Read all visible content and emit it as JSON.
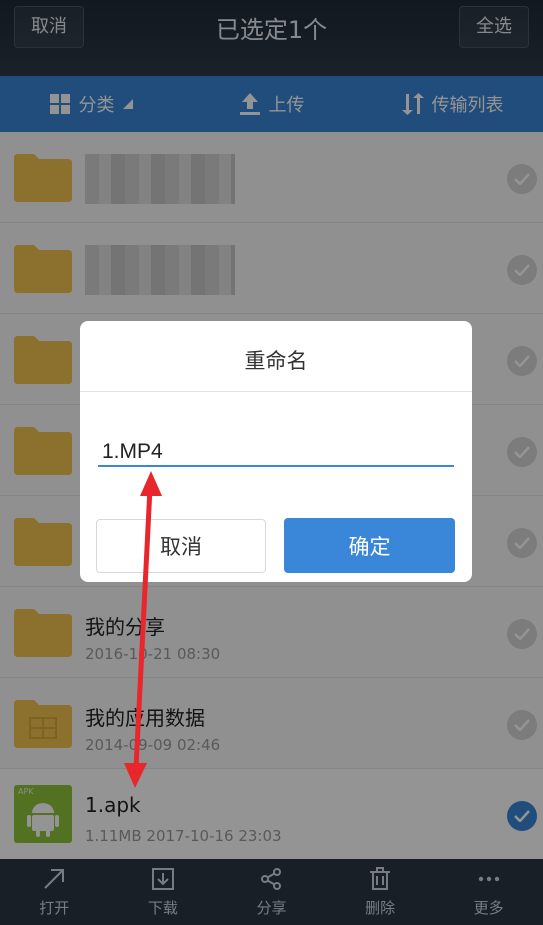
{
  "topbar": {
    "cancel_label": "取消",
    "title": "已选定1个",
    "select_all_label": "全选"
  },
  "toolbar": {
    "category_label": "分类",
    "upload_label": "上传",
    "transfer_label": "传输列表"
  },
  "files": [
    {
      "name": "",
      "meta": "",
      "type": "folder",
      "blurred": true,
      "checked": false
    },
    {
      "name": "",
      "meta": "",
      "type": "folder",
      "blurred": true,
      "checked": false
    },
    {
      "name": "",
      "meta": "",
      "type": "folder",
      "blurred": false,
      "checked": false
    },
    {
      "name": "",
      "meta": "",
      "type": "folder",
      "blurred": false,
      "checked": false
    },
    {
      "name": "",
      "meta": "",
      "type": "folder",
      "blurred": false,
      "checked": false
    },
    {
      "name": "我的分享",
      "meta": "2016-10-21  08:30",
      "type": "folder",
      "blurred": false,
      "checked": false
    },
    {
      "name": "我的应用数据",
      "meta": "2014-09-09  02:46",
      "type": "folder",
      "blurred": false,
      "checked": false
    },
    {
      "name": "1.apk",
      "meta": "1.11MB   2017-10-16  23:03",
      "type": "apk",
      "badge": "APK",
      "blurred": false,
      "checked": true
    }
  ],
  "bottombar": {
    "open_label": "打开",
    "download_label": "下载",
    "share_label": "分享",
    "delete_label": "删除",
    "more_label": "更多"
  },
  "dialog": {
    "title": "重命名",
    "input_value": "1.MP4",
    "cancel_label": "取消",
    "ok_label": "确定"
  },
  "colors": {
    "accent": "#3a86d8",
    "folder": "#f2c14e",
    "annotation_arrow": "#e8262b"
  },
  "icons": {
    "toolbar": [
      "grid-icon",
      "upload-icon",
      "transfer-icon"
    ],
    "bottombar": [
      "open-arrow-icon",
      "download-icon",
      "share-icon",
      "trash-icon",
      "more-dots-icon"
    ]
  }
}
